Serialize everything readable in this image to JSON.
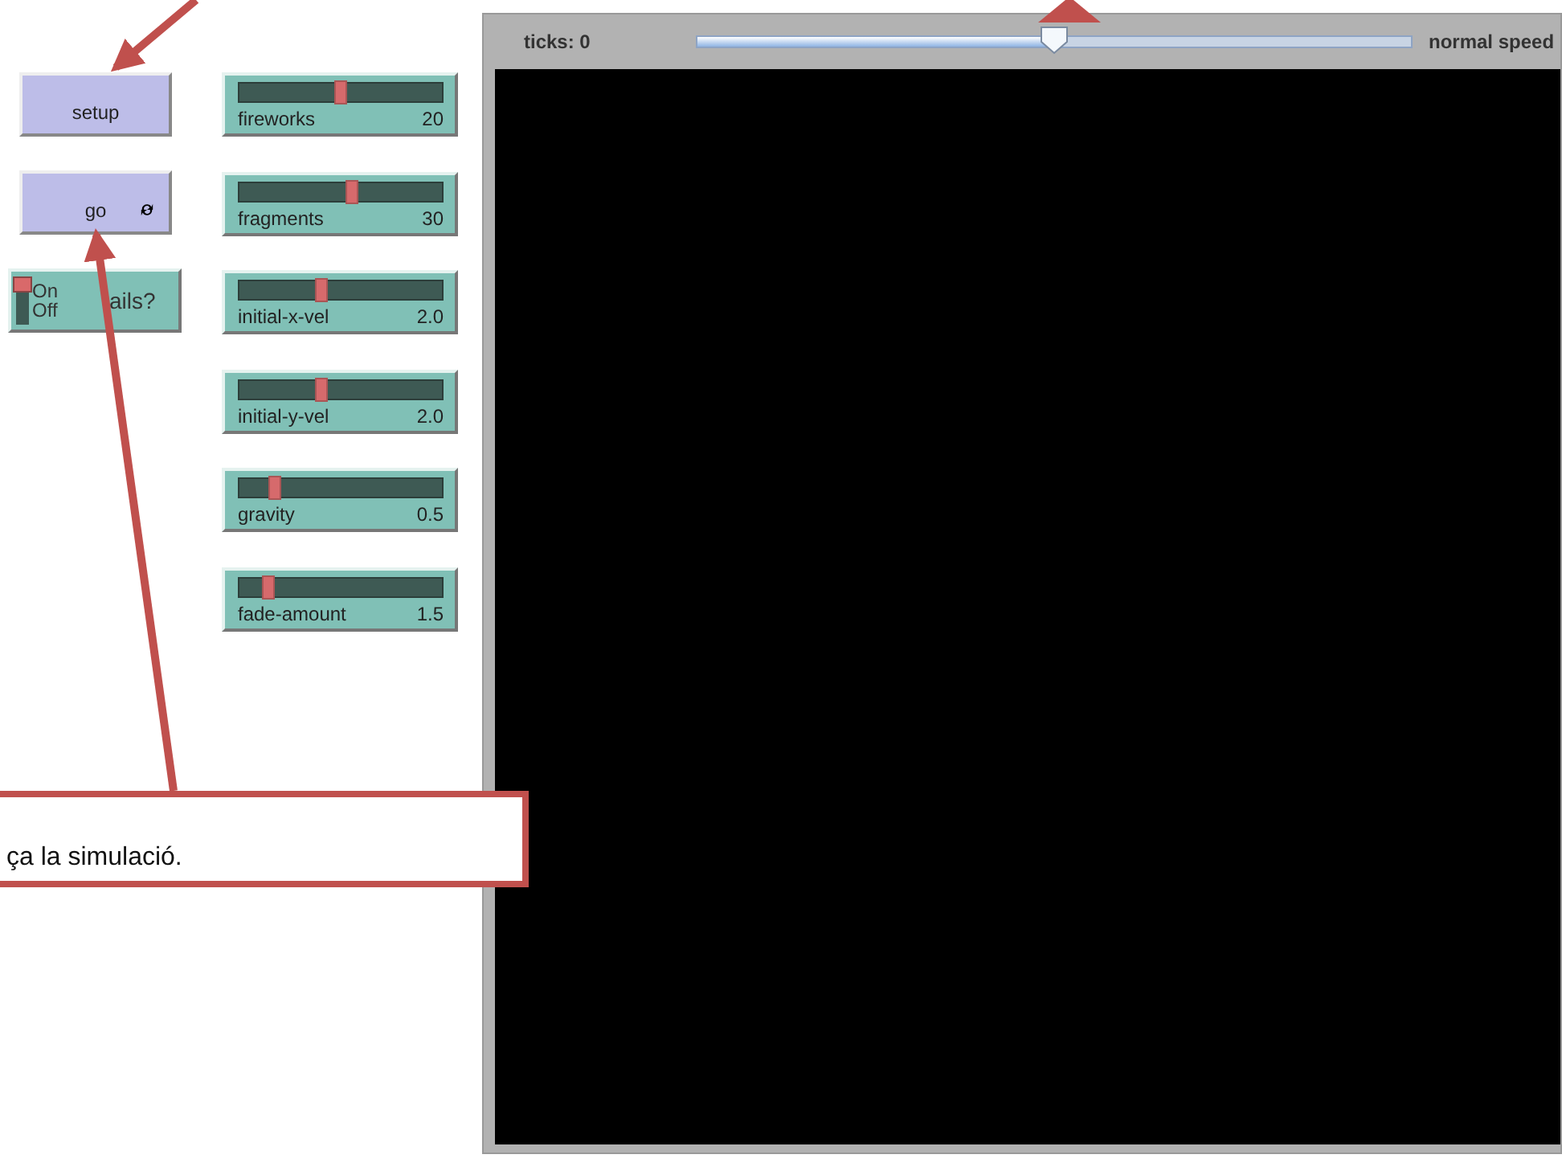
{
  "buttons": [
    {
      "label": "setup",
      "forever": false
    },
    {
      "label": "go",
      "forever": true
    }
  ],
  "switch": {
    "on_label": "On",
    "off_label": "Off",
    "label": "ails?",
    "on": true
  },
  "sliders": [
    {
      "name": "fireworks",
      "reading": "20",
      "level": 0.5
    },
    {
      "name": "fragments",
      "reading": "30",
      "level": 0.56
    },
    {
      "name": "initial-x-vel",
      "reading": "2.0",
      "level": 0.4
    },
    {
      "name": "initial-y-vel",
      "reading": "2.0",
      "level": 0.4
    },
    {
      "name": "gravity",
      "reading": "0.5",
      "level": 0.15
    },
    {
      "name": "fade-amount",
      "reading": "1.5",
      "level": 0.12
    }
  ],
  "view": {
    "ticks": "ticks: 0",
    "speed_label": "normal speed",
    "speed": {
      "level": 0.5
    }
  },
  "callout": {
    "text": "ça la simulació."
  }
}
